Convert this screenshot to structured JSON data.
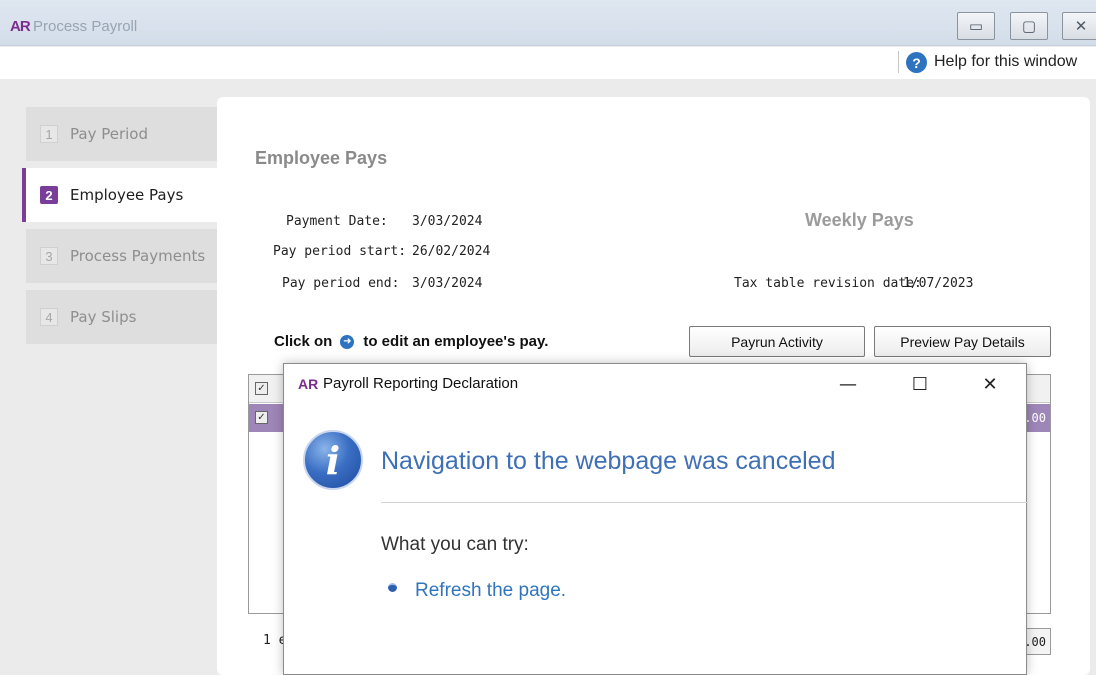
{
  "window": {
    "logo": "AR",
    "title": "Process Payroll",
    "minimize": "▭",
    "maximize": "▢",
    "close": "✕"
  },
  "help": {
    "icon": "?",
    "label": "Help for this window"
  },
  "steps": [
    {
      "num": "1",
      "label": "Pay Period"
    },
    {
      "num": "2",
      "label": "Employee Pays"
    },
    {
      "num": "3",
      "label": "Process Payments"
    },
    {
      "num": "4",
      "label": "Pay Slips"
    }
  ],
  "main": {
    "section_title": "Employee Pays",
    "payment_date_label": "Payment Date:",
    "payment_date": "3/03/2024",
    "period_start_label": "Pay period start:",
    "period_start": "26/02/2024",
    "period_end_label": "Pay period end:",
    "period_end": "3/03/2024",
    "pays_type": "Weekly Pays",
    "tax_table_label": "Tax table revision date:",
    "tax_table_date": "1/07/2023",
    "instruction_prefix": "Click on",
    "instruction_suffix": "to edit an employee's pay.",
    "payrun_activity_button": "Payrun Activity",
    "preview_button": "Preview Pay Details",
    "row_amount_partial": ".00",
    "footer_count_partial": "1 e",
    "footer_total_partial": ".00"
  },
  "dialog": {
    "logo": "AR",
    "title": "Payroll Reporting Declaration",
    "minimize": "—",
    "maximize": "☐",
    "close": "✕",
    "info_icon": "i",
    "heading": "Navigation to the webpage was canceled",
    "try_label": "What you can try:",
    "refresh_link": "Refresh the page."
  },
  "colors": {
    "accent_purple": "#7a3d9a",
    "selected_row": "#9e86b8",
    "link_blue": "#2f74bd"
  }
}
